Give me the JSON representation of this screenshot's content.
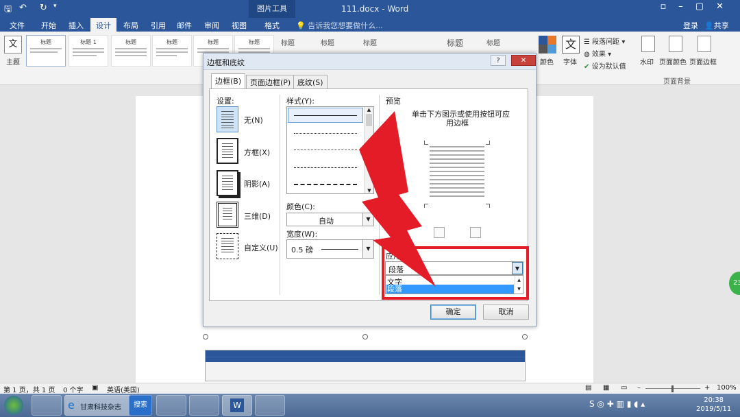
{
  "titlebar": {
    "context_tools": "图片工具",
    "doc_title": "111.docx - Word",
    "accent": "#2b579a"
  },
  "tabs": {
    "items": [
      "文件",
      "开始",
      "插入",
      "设计",
      "布局",
      "引用",
      "邮件",
      "审阅",
      "视图",
      "格式"
    ],
    "active": "设计",
    "tellme": "告诉我您想要做什么...",
    "login": "登录",
    "share": "共享"
  },
  "ribbon": {
    "theme_label": "主题",
    "style_thumb_titles": [
      "标题",
      "标题 1",
      "标题",
      "标题",
      "标题",
      "标题"
    ],
    "style_heads": [
      "标题",
      "标题",
      "标题",
      "标题",
      "标题"
    ],
    "colors_label": "颜色",
    "fonts_label": "字体",
    "fonts_icon_text": "文",
    "paragraph_spacing": "段落间距",
    "effects": "效果",
    "set_default": "设为默认值",
    "watermark": "水印",
    "page_color": "页面颜色",
    "page_borders": "页面边框",
    "group_page_bg": "页面背景"
  },
  "dialog": {
    "title": "边框和底纹",
    "help": "?",
    "close": "✕",
    "tabs": [
      "边框(B)",
      "页面边框(P)",
      "底纹(S)"
    ],
    "settings_label": "设置:",
    "settings": [
      "无(N)",
      "方框(X)",
      "阴影(A)",
      "三维(D)",
      "自定义(U)"
    ],
    "style_label": "样式(Y):",
    "color_label": "颜色(C):",
    "color_value": "自动",
    "width_label": "宽度(W):",
    "width_value": "0.5 磅",
    "preview_label": "预览",
    "preview_hint_1": "单击下方图示或使用按钮可应",
    "preview_hint_2": "用边框",
    "apply_label": "应用于(",
    "apply_value": "段落",
    "apply_options": [
      "文字",
      "段落"
    ],
    "ok": "确定",
    "cancel": "取消",
    "highlight_color": "#e41c27"
  },
  "status": {
    "page": "第 1 页，共 1 页",
    "words": "0 个字",
    "language": "英语(美国)",
    "zoom": "100%"
  },
  "taskbar": {
    "item_label": "甘肃科技杂志",
    "search_label": "搜索",
    "time": "20:38",
    "date": "2019/5/11"
  },
  "side_badge": "23"
}
